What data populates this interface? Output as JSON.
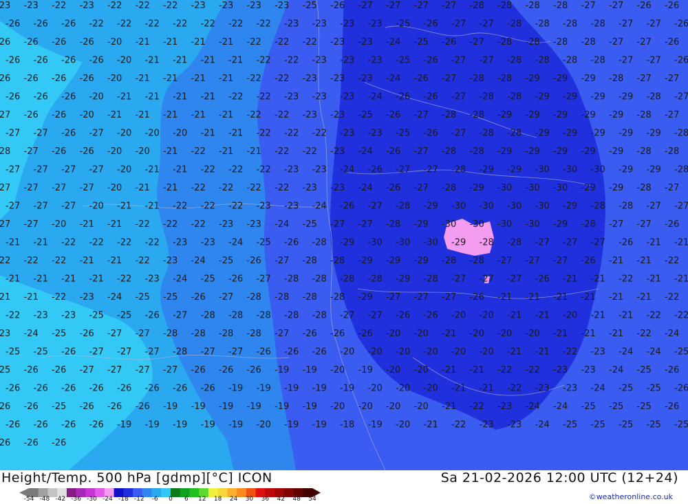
{
  "map": {
    "background_color": "#3a5cf0",
    "region_colors": {
      "far_west": "#33c8f5",
      "west": "#2aa8f0",
      "mid": "#2f86ee",
      "east_band": "#3a5cf0",
      "core": "#2030dd",
      "hot": "#f49cf0"
    },
    "contour_labels": [
      "-23",
      "-23",
      "-22",
      "-23",
      "-22",
      "-22",
      "-22",
      "-23",
      "-23",
      "-23",
      "-23",
      "-25",
      "-26",
      "-27",
      "-27",
      "-27",
      "-27",
      "-28",
      "-28",
      "-28",
      "-28",
      "-27",
      "-27",
      "-26",
      "-26",
      "-26",
      "-26",
      "-26",
      "-22",
      "-22",
      "-22",
      "-22",
      "-22",
      "-22",
      "-22",
      "-23",
      "-23",
      "-23",
      "-23",
      "-25",
      "-26",
      "-27",
      "-27",
      "-28",
      "-28",
      "-28",
      "-28",
      "-27",
      "-27",
      "-26",
      "-26",
      "-26",
      "-26",
      "-26",
      "-20",
      "-21",
      "-21",
      "-21",
      "-21",
      "-22",
      "-22",
      "-22",
      "-23",
      "-23",
      "-24",
      "-25",
      "-26",
      "-27",
      "-28",
      "-28",
      "-28",
      "-28",
      "-27",
      "-27",
      "-26",
      "-26",
      "-26",
      "-26",
      "-26",
      "-20",
      "-21",
      "-21",
      "-21",
      "-21",
      "-22",
      "-22",
      "-23",
      "-23",
      "-23",
      "-25",
      "-26",
      "-27",
      "-27",
      "-28",
      "-28",
      "-28",
      "-28",
      "-27",
      "-27",
      "-26",
      "-26",
      "-26",
      "-26",
      "-26",
      "-20",
      "-21",
      "-21",
      "-21",
      "-21",
      "-22",
      "-22",
      "-23",
      "-23",
      "-23",
      "-24",
      "-26",
      "-27",
      "-28",
      "-28",
      "-29",
      "-29",
      "-29",
      "-28",
      "-27",
      "-27",
      "-26",
      "-26",
      "-26",
      "-20",
      "-21",
      "-21",
      "-21",
      "-21",
      "-22",
      "-22",
      "-23",
      "-23",
      "-23",
      "-24",
      "-26",
      "-26",
      "-27",
      "-28",
      "-28",
      "-29",
      "-29",
      "-29",
      "-29",
      "-28",
      "-27",
      "-27",
      "-26",
      "-26",
      "-20",
      "-21",
      "-21",
      "-21",
      "-21",
      "-21",
      "-22",
      "-22",
      "-23",
      "-23",
      "-25",
      "-26",
      "-27",
      "-28",
      "-28",
      "-29",
      "-29",
      "-29",
      "-29",
      "-29",
      "-28",
      "-27",
      "-27",
      "-27",
      "-26",
      "-27",
      "-20",
      "-20",
      "-20",
      "-21",
      "-21",
      "-22",
      "-22",
      "-22",
      "-23",
      "-23",
      "-25",
      "-26",
      "-27",
      "-28",
      "-28",
      "-29",
      "-29",
      "-29",
      "-29",
      "-29",
      "-28",
      "-28",
      "-27",
      "-26",
      "-26",
      "-20",
      "-20",
      "-21",
      "-22",
      "-21",
      "-21",
      "-22",
      "-22",
      "-23",
      "-24",
      "-26",
      "-27",
      "-28",
      "-28",
      "-29",
      "-29",
      "-29",
      "-29",
      "-29",
      "-28",
      "-28",
      "-27",
      "-27",
      "-27",
      "-27",
      "-20",
      "-21",
      "-21",
      "-22",
      "-22",
      "-22",
      "-23",
      "-23",
      "-24",
      "-26",
      "-27",
      "-27",
      "-28",
      "-29",
      "-29",
      "-30",
      "-30",
      "-30",
      "-29",
      "-29",
      "-28",
      "-27",
      "-27",
      "-27",
      "-27",
      "-20",
      "-21",
      "-21",
      "-22",
      "-22",
      "-22",
      "-22",
      "-23",
      "-23",
      "-24",
      "-26",
      "-27",
      "-28",
      "-29",
      "-30",
      "-30",
      "-30",
      "-29",
      "-29",
      "-28",
      "-27",
      "-27",
      "-27",
      "-27",
      "-20",
      "-21",
      "-21",
      "-22",
      "-22",
      "-22",
      "-23",
      "-23",
      "-24",
      "-26",
      "-27",
      "-28",
      "-29",
      "-30",
      "-30",
      "-30",
      "-30",
      "-29",
      "-28",
      "-28",
      "-27",
      "-27",
      "-27",
      "-27",
      "-20",
      "-21",
      "-21",
      "-22",
      "-22",
      "-22",
      "-23",
      "-23",
      "-24",
      "-25",
      "-27",
      "-27",
      "-28",
      "-29",
      "-30",
      "-30",
      "-30",
      "-30",
      "-29",
      "-28",
      "-27",
      "-27",
      "-26",
      "-21",
      "-21",
      "-22",
      "-22",
      "-22",
      "-22",
      "-23",
      "-23",
      "-24",
      "-25",
      "-26",
      "-28",
      "-29",
      "-30",
      "-30",
      "-30",
      "-29",
      "-28",
      "-28",
      "-27",
      "-27",
      "-27",
      "-26",
      "-21",
      "-21",
      "-22",
      "-22",
      "-22",
      "-21",
      "-21",
      "-22",
      "-23",
      "-24",
      "-25",
      "-26",
      "-27",
      "-28",
      "-28",
      "-29",
      "-29",
      "-29",
      "-28",
      "-28",
      "-27",
      "-27",
      "-27",
      "-26",
      "-21",
      "-21",
      "-22",
      "-21",
      "-21",
      "-21",
      "-21",
      "-22",
      "-23",
      "-24",
      "-25",
      "-26",
      "-27",
      "-28",
      "-28",
      "-28",
      "-28",
      "-29",
      "-28",
      "-27",
      "-27",
      "-27",
      "-26",
      "-21",
      "-21",
      "-22",
      "-21",
      "-21",
      "-21",
      "-21",
      "-22",
      "-23",
      "-24",
      "-25",
      "-25",
      "-26",
      "-27",
      "-28",
      "-28",
      "-28",
      "-28",
      "-29",
      "-27",
      "-27",
      "-27",
      "-26",
      "-21",
      "-21",
      "-21",
      "-21",
      "-21",
      "-21",
      "-22",
      "-22",
      "-23",
      "-23",
      "-25",
      "-25",
      "-26",
      "-27",
      "-28",
      "-28",
      "-28",
      "-28",
      "-28",
      "-27",
      "-27",
      "-26",
      "-26",
      "-20",
      "-20",
      "-21",
      "-21",
      "-20",
      "-21",
      "-21",
      "-22",
      "-22",
      "-23",
      "-24",
      "-25",
      "-26",
      "-27",
      "-27",
      "-28",
      "-28",
      "-28",
      "-28",
      "-27",
      "-26",
      "-26",
      "-26",
      "-20",
      "-20",
      "-21",
      "-20",
      "-20",
      "-20",
      "-21",
      "-21",
      "-21",
      "-22",
      "-24",
      "-25",
      "-25",
      "-26",
      "-27",
      "-27",
      "-27",
      "-28",
      "-27",
      "-27",
      "-26",
      "-26",
      "-26",
      "-20",
      "-20",
      "-20",
      "-20",
      "-20",
      "-20",
      "-21",
      "-21",
      "-22",
      "-23",
      "-24",
      "-24",
      "-25",
      "-25",
      "-26",
      "-26",
      "-27",
      "-27",
      "-27",
      "-27",
      "-26",
      "-26",
      "-26",
      "-19",
      "-19",
      "-20",
      "-19",
      "-20",
      "-20",
      "-21",
      "-21",
      "-22",
      "-22",
      "-23",
      "-23",
      "-24",
      "-25",
      "-26",
      "-26",
      "-26",
      "-26",
      "-26",
      "-26",
      "-26",
      "-26",
      "-26",
      "-19",
      "-19",
      "-19",
      "-19",
      "-19",
      "-20",
      "-20",
      "-20",
      "-21",
      "-21",
      "-22",
      "-23",
      "-23",
      "-24",
      "-25",
      "-25",
      "-26",
      "-26",
      "-26",
      "-25",
      "-26",
      "-26",
      "-26",
      "-19",
      "-19",
      "-19",
      "-19",
      "-19",
      "-19",
      "-20",
      "-20",
      "-20",
      "-20",
      "-21",
      "-22",
      "-23",
      "-24",
      "-24",
      "-25",
      "-25",
      "-25",
      "-26",
      "-26",
      "-26",
      "-26",
      "-26",
      "-19",
      "-19",
      "-19",
      "-19",
      "-19",
      "-20",
      "-19",
      "-19",
      "-18",
      "-19",
      "-20",
      "-21",
      "-22",
      "-23",
      "-23",
      "-24",
      "-25",
      "-25",
      "-25",
      "-25",
      "-25",
      "-26",
      "-26",
      "-26"
    ]
  },
  "footer": {
    "title_left": "Height/Temp. 500 hPa [gdmp][°C] ICON",
    "title_right": "Sa 21-02-2026 12:00 UTC (12+24)",
    "credit": "©weatheronline.co.uk",
    "scale_ticks": [
      "-54",
      "-48",
      "-42",
      "-36",
      "-30",
      "-24",
      "-18",
      "-12",
      "-6",
      "0",
      "6",
      "12",
      "18",
      "24",
      "30",
      "36",
      "42",
      "48",
      "54"
    ],
    "scale_colors": [
      "#7a7a7a",
      "#a0a0a0",
      "#c4c4c4",
      "#e0e0e0",
      "#8a1a8a",
      "#a628b8",
      "#c836d8",
      "#e25ae8",
      "#f39cf0",
      "#1010c8",
      "#2030dd",
      "#3a5cf0",
      "#2f86ee",
      "#2aa8f0",
      "#33c8f5",
      "#0a7a1a",
      "#10a020",
      "#20c020",
      "#60d830",
      "#f0f040",
      "#f8d838",
      "#f8b030",
      "#f88a20",
      "#f05010",
      "#e01010",
      "#c00808",
      "#a00606",
      "#800404",
      "#600202",
      "#400101"
    ]
  }
}
